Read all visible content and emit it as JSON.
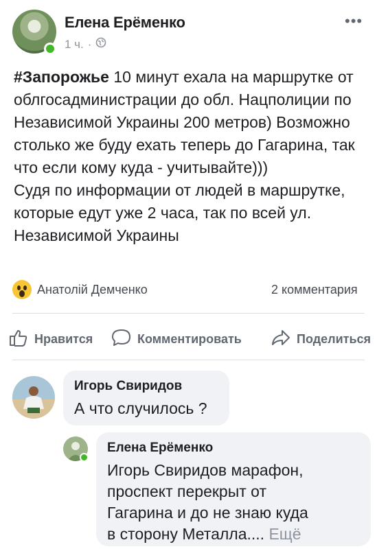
{
  "post": {
    "author": "Елена Ерёменко",
    "time": "1 ч.",
    "separator": "·",
    "hashtag": "#Запорожье",
    "text_1": " 10 минут ехала на маршрутке от облгосадминистрации до обл. Нацполиции по Независимой Украины 200 метров) Возможно столько же буду ехать теперь до Гагарина, так что если кому куда - учитывайте)))",
    "text_2": "Судя по информации от людей в маршрутке, которые едут уже 2 часа, так по всей ул. Независимой Украины",
    "more_icon": "•••"
  },
  "reactions": {
    "icon": "wow-emoji",
    "reactor": "Анатолій Демченко",
    "comments_count": "2 комментария"
  },
  "actions": {
    "like": "Нравится",
    "comment": "Комментировать",
    "share": "Поделиться"
  },
  "comments": [
    {
      "author": "Игорь Свиридов",
      "text": "А что случилось ?"
    },
    {
      "author": "Елена Ерёменко",
      "text": "Игорь Свиридов марафон, проспект перекрыт от Гагарина и до не знаю куда в сторону Металла....",
      "more": "Ещё"
    }
  ],
  "colors": {
    "online": "#42b72a",
    "bubble": "#f0f2f5",
    "muted": "#8d949e"
  }
}
